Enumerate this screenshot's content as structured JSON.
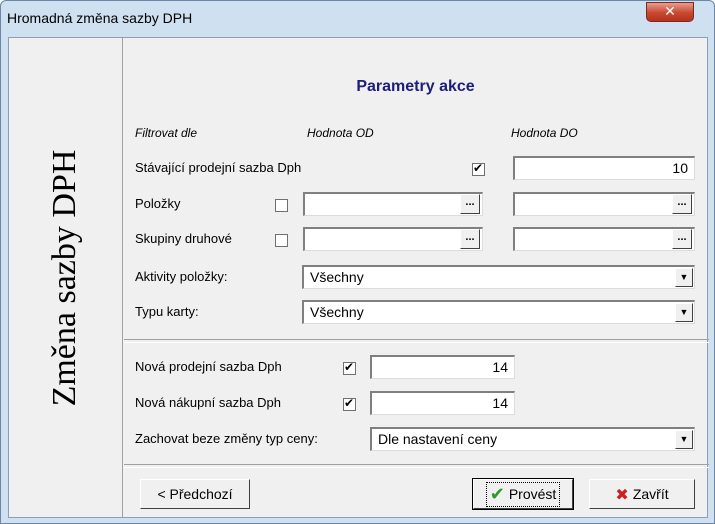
{
  "window": {
    "title": "Hromadná změna sazby DPH",
    "close_glyph": "✕"
  },
  "side_title": "Změna sazby DPH",
  "section_title": "Parametry akce",
  "headers": {
    "filter_by": "Filtrovat dle",
    "value_from": "Hodnota OD",
    "value_to": "Hodnota DO"
  },
  "rows": {
    "current_rate": {
      "label": "Stávající prodejní sazba Dph",
      "checked": true,
      "to_value": "10"
    },
    "items": {
      "label": "Položky",
      "checked": false,
      "from_value": "",
      "to_value": ""
    },
    "groups": {
      "label": "Skupiny druhové",
      "checked": false,
      "from_value": "",
      "to_value": ""
    }
  },
  "item_activity": {
    "label": "Aktivity položky:",
    "value": "Všechny"
  },
  "card_type": {
    "label": "Typu karty:",
    "value": "Všechny"
  },
  "new_sale_rate": {
    "label": "Nová prodejní sazba Dph",
    "checked": true,
    "value": "14"
  },
  "new_purchase_rate": {
    "label": "Nová nákupní sazba Dph",
    "checked": true,
    "value": "14"
  },
  "keep_price_type": {
    "label": "Zachovat beze změny typ ceny:",
    "value": "Dle nastavení ceny"
  },
  "buttons": {
    "previous": "< Předchozí",
    "execute": "Provést",
    "close": "Zavřít"
  },
  "icons": {
    "ellipsis": "...",
    "dropdown": "▼",
    "check": "✔",
    "cross": "✖"
  },
  "colors": {
    "section_title": "#1d1d7a",
    "close_button": "#c8482f",
    "check_green": "#2e9a2e",
    "cross_red": "#cc1f1f"
  }
}
